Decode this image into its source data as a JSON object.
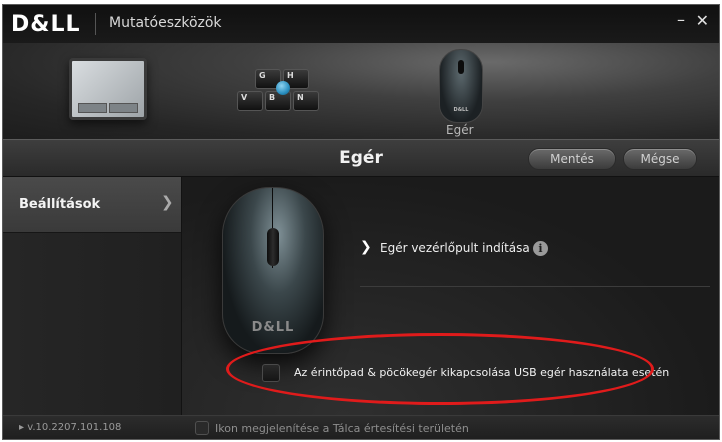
{
  "window": {
    "brand": "D&LL",
    "title": "Mutatóeszközök",
    "minimize_glyph": "–",
    "close_glyph": "✕"
  },
  "devices": {
    "keyboard_keys": [
      "G",
      "H",
      "V",
      "B",
      "N"
    ],
    "mouse_label": "Egér",
    "selected": "mouse"
  },
  "header": {
    "title": "Egér",
    "save_label": "Mentés",
    "cancel_label": "Mégse"
  },
  "sidebar": {
    "items": [
      {
        "label": "Beállítások",
        "selected": true
      }
    ]
  },
  "main": {
    "mouse_brand": "D&LL",
    "launch_chevron": "❯",
    "launch_label": "Egér vezérlőpult indítása",
    "info_glyph": "i",
    "disable_label": "Az érintőpad & pöcökegér kikapcsolása USB egér használata esetén",
    "disable_checked": false
  },
  "footer": {
    "version": "▸ v.10.2207.101.108",
    "tray_label": "Ikon megjelenítése a Tálca értesítési területén",
    "tray_checked": false
  },
  "colors": {
    "highlight_ellipse": "#e01b1b",
    "background": "#1e1e1e",
    "sidebar_selected": "#444444"
  }
}
